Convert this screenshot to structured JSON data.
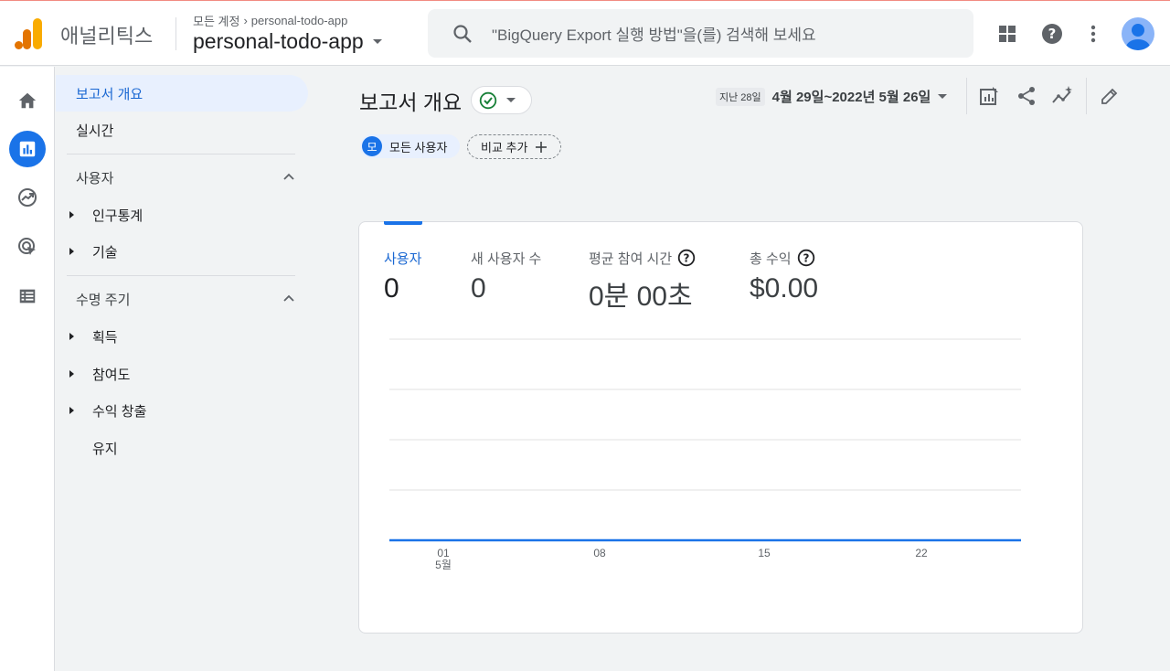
{
  "header": {
    "product_name": "애널리틱스",
    "breadcrumb_all": "모든 계정",
    "breadcrumb_current": "personal-todo-app",
    "property_name": "personal-todo-app",
    "search_placeholder": "\"BigQuery Export 실행 방법\"을(를) 검색해 보세요"
  },
  "rail": {
    "icons": [
      "home-icon",
      "reports-icon",
      "explore-icon",
      "advertising-icon",
      "configure-icon"
    ]
  },
  "sidenav": {
    "items": [
      {
        "label": "보고서 개요",
        "active": true
      },
      {
        "label": "실시간"
      }
    ],
    "sections": [
      {
        "title": "사용자",
        "items": [
          "인구통계",
          "기술"
        ]
      },
      {
        "title": "수명 주기",
        "items": [
          "획득",
          "참여도",
          "수익 창출"
        ],
        "extra": "유지"
      }
    ]
  },
  "main": {
    "title": "보고서 개요",
    "date_tag": "지난 28일",
    "date_range": "4월 29일~2022년 5월 26일",
    "segment_badge": "모",
    "segment_label": "모든 사용자",
    "add_comparison": "비교 추가"
  },
  "metrics": [
    {
      "label": "사용자",
      "value": "0",
      "active": true
    },
    {
      "label": "새 사용자 수",
      "value": "0"
    },
    {
      "label": "평균 참여 시간",
      "value": "0분 00초",
      "help": true
    },
    {
      "label": "총 수익",
      "value": "$0.00",
      "help": true
    }
  ],
  "chart_data": {
    "type": "line",
    "x": [
      "01",
      "08",
      "15",
      "22"
    ],
    "x_sub": [
      "5월",
      "",
      "",
      ""
    ],
    "series": [
      {
        "values": [
          0,
          0,
          0,
          0
        ]
      }
    ],
    "grid": true
  },
  "colors": {
    "accent": "#1a73e8",
    "active_nav_bg": "#e8f0fe",
    "logo_orange": "#f9ab00",
    "logo_dark": "#e37400"
  }
}
